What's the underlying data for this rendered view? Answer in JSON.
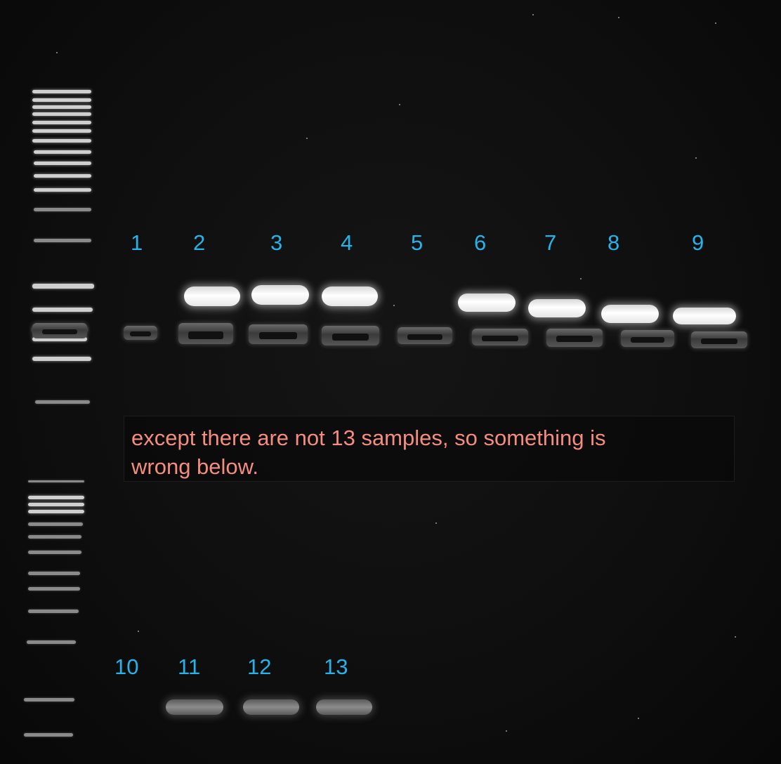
{
  "lane_labels_top": [
    "1",
    "2",
    "3",
    "4",
    "5",
    "6",
    "7",
    "8",
    "9"
  ],
  "lane_labels_bottom": [
    "10",
    "11",
    "12",
    "13"
  ],
  "note": {
    "line1": "except there are not 13 samples, so something is",
    "line2": "wrong below."
  },
  "colors": {
    "lane_label": "#26b3ea",
    "note_text": "#f48c80",
    "background": "#0e0e0e"
  }
}
